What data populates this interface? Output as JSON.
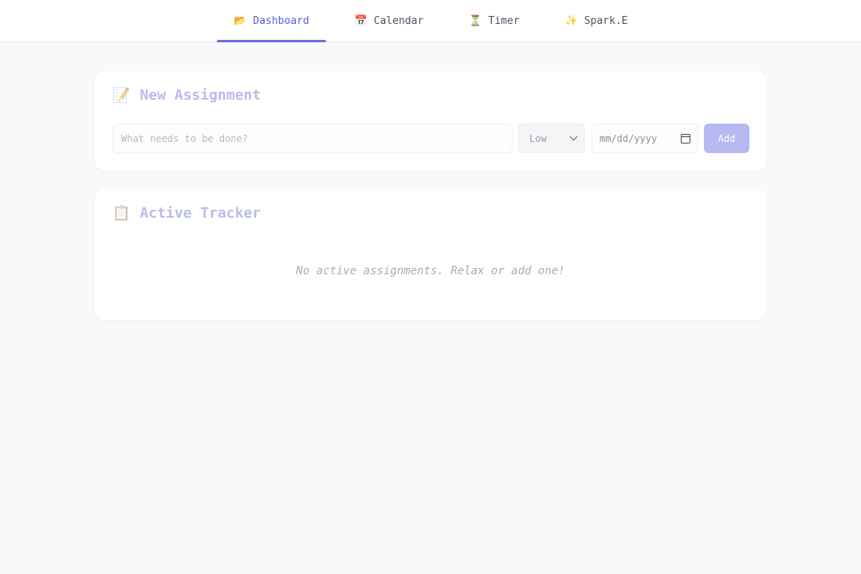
{
  "nav": {
    "tabs": [
      {
        "icon": "📂",
        "label": "Dashboard",
        "active": true
      },
      {
        "icon": "📅",
        "label": "Calendar",
        "active": false
      },
      {
        "icon": "⏳",
        "label": "Timer",
        "active": false
      },
      {
        "icon": "✨",
        "label": "Spark.E",
        "active": false
      }
    ]
  },
  "new_assignment": {
    "icon": "📝",
    "title": "New Assignment",
    "task_placeholder": "What needs to be done?",
    "task_value": "",
    "priority_value": "Low",
    "date_placeholder": "mm/dd/yyyy",
    "add_label": "Add"
  },
  "tracker": {
    "icon": "📋",
    "title": "Active Tracker",
    "empty_message": "No active assignments. Relax or add one!"
  },
  "colors": {
    "accent": "#6b6ee0",
    "accent_text": "#5b5fd6",
    "button_bg": "#b6b8f2",
    "title_color": "#b9bcec",
    "page_bg": "#f8f9fb"
  }
}
